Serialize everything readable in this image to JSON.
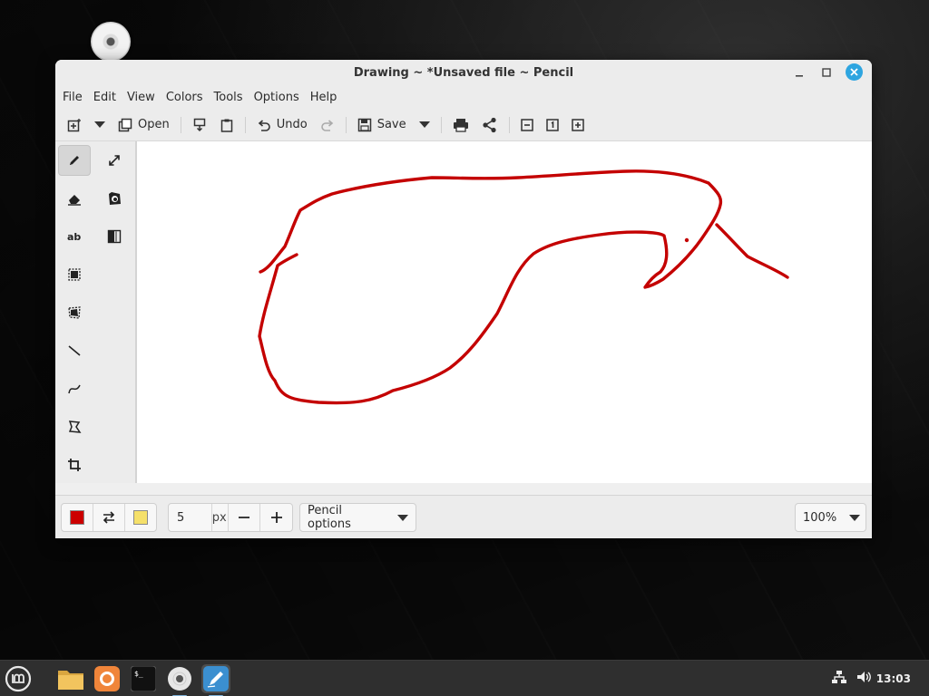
{
  "window": {
    "title": "Drawing ~ *Unsaved file ~ Pencil"
  },
  "menubar": {
    "items": [
      "File",
      "Edit",
      "View",
      "Colors",
      "Tools",
      "Options",
      "Help"
    ]
  },
  "toolbar": {
    "open_label": "Open",
    "undo_label": "Undo",
    "save_label": "Save"
  },
  "tools": {
    "active": "pencil",
    "items": [
      "pencil",
      "expand",
      "eraser",
      "color-picker",
      "text",
      "filters",
      "rect-select",
      "free-select",
      "line",
      "curve",
      "shape",
      "crop"
    ]
  },
  "options_bar": {
    "main_color": "#cc0000",
    "secondary_color": "#f5e06a",
    "size_value": "5",
    "size_unit": "px",
    "tool_options_label": "Pencil options",
    "zoom_label": "100%"
  },
  "drawing": {
    "stroke_color": "#c40000"
  },
  "taskbar": {
    "clock": "13:03"
  }
}
